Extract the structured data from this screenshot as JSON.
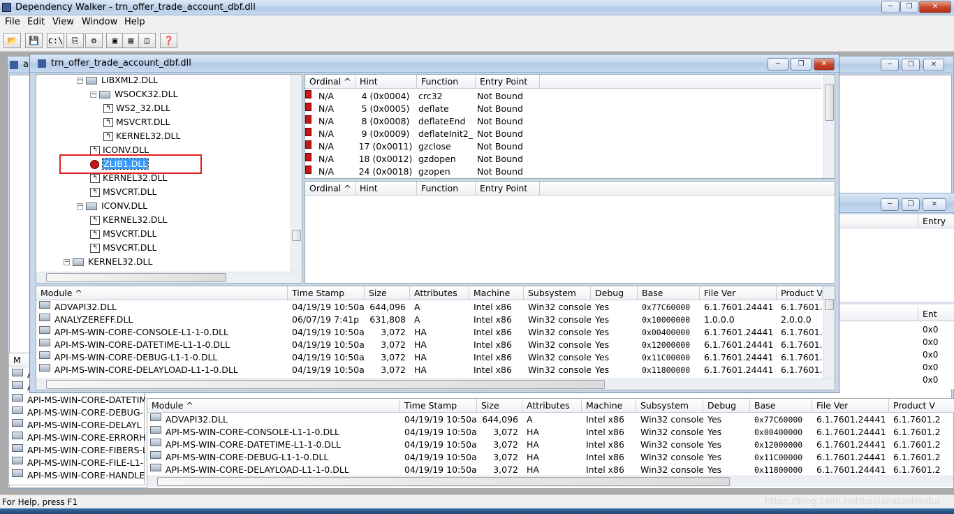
{
  "app": {
    "title": "Dependency Walker - trn_offer_trade_account_dbf.dll",
    "status": "For Help, press F1",
    "watermark": "https://blog.csdn.net/baijianxiaofendui"
  },
  "menu": [
    "File",
    "Edit",
    "View",
    "Window",
    "Help"
  ],
  "toolbar": {
    "b1": "open-icon",
    "b2": "save-icon",
    "b3": "c:\\",
    "b4": "copy-icon",
    "b5": "config-icon",
    "b6": "full-paths-icon",
    "b7": "undecorate-icon",
    "b8": "cascade-icon",
    "b9": "tile-horizontal-icon",
    "b10": "tile-vertical-icon",
    "b11": "help-icon"
  },
  "bgwin": {
    "title": "a",
    "entry": "Entry",
    "ent": "Ent",
    "m": "M",
    "ox": [
      "0x0",
      "0x0",
      "0x0",
      "0x0",
      "0x0"
    ],
    "left_items": [
      "A",
      "A",
      "API-MS-WIN-CORE-DATETIM",
      "API-MS-WIN-CORE-DEBUG-",
      "API-MS-WIN-CORE-DELAYL",
      "API-MS-WIN-CORE-ERRORH",
      "API-MS-WIN-CORE-FIBERS-L",
      "API-MS-WIN-CORE-FILE-L1-",
      "API-MS-WIN-CORE-HANDLE"
    ]
  },
  "child": {
    "title": "trn_offer_trade_account_dbf.dll"
  },
  "tree": [
    {
      "label": "LIBXML2.DLL",
      "exp": "−"
    },
    {
      "label": "WSOCK32.DLL",
      "exp": "−"
    },
    {
      "label": "WS2_32.DLL"
    },
    {
      "label": "MSVCRT.DLL"
    },
    {
      "label": "KERNEL32.DLL"
    },
    {
      "label": "ICONV.DLL"
    },
    {
      "label": "ZLIB1.DLL"
    },
    {
      "label": "KERNEL32.DLL"
    },
    {
      "label": "MSVCRT.DLL"
    },
    {
      "label": "ICONV.DLL",
      "exp": "−"
    },
    {
      "label": "KERNEL32.DLL"
    },
    {
      "label": "MSVCRT.DLL"
    },
    {
      "label": "MSVCRT.DLL"
    },
    {
      "label": "KERNEL32.DLL",
      "exp": "−"
    }
  ],
  "import_headers": [
    "Ordinal ^",
    "Hint",
    "Function",
    "Entry Point"
  ],
  "imports": [
    [
      "N/A",
      "4  (0x0004)",
      "crc32",
      "Not Bound"
    ],
    [
      "N/A",
      "5  (0x0005)",
      "deflate",
      "Not Bound"
    ],
    [
      "N/A",
      "8  (0x0008)",
      "deflateEnd",
      "Not Bound"
    ],
    [
      "N/A",
      "9  (0x0009)",
      "deflateInit2_",
      "Not Bound"
    ],
    [
      "N/A",
      "17  (0x0011)",
      "gzclose",
      "Not Bound"
    ],
    [
      "N/A",
      "18  (0x0012)",
      "gzdopen",
      "Not Bound"
    ],
    [
      "N/A",
      "24  (0x0018)",
      "gzopen",
      "Not Bound"
    ]
  ],
  "module_headers": [
    "Module ^",
    "Time Stamp",
    "Size",
    "Attributes",
    "Machine",
    "Subsystem",
    "Debug",
    "Base",
    "File Ver",
    "Product V"
  ],
  "modules": [
    [
      "ADVAPI32.DLL",
      "04/19/19  10:50a",
      "644,096",
      "A",
      "Intel x86",
      "Win32 console",
      "Yes",
      "0x77C60000",
      "6.1.7601.24441",
      "6.1.7601.2"
    ],
    [
      "ANALYZEREFF.DLL",
      "06/07/19    7:41p",
      "631,808",
      "A",
      "Intel x86",
      "Win32 console",
      "Yes",
      "0x10000000",
      "1.0.0.0",
      "2.0.0.0"
    ],
    [
      "API-MS-WIN-CORE-CONSOLE-L1-1-0.DLL",
      "04/19/19  10:50a",
      "3,072",
      "HA",
      "Intel x86",
      "Win32 console",
      "Yes",
      "0x00400000",
      "6.1.7601.24441",
      "6.1.7601.2"
    ],
    [
      "API-MS-WIN-CORE-DATETIME-L1-1-0.DLL",
      "04/19/19  10:50a",
      "3,072",
      "HA",
      "Intel x86",
      "Win32 console",
      "Yes",
      "0x12000000",
      "6.1.7601.24441",
      "6.1.7601.2"
    ],
    [
      "API-MS-WIN-CORE-DEBUG-L1-1-0.DLL",
      "04/19/19  10:50a",
      "3,072",
      "HA",
      "Intel x86",
      "Win32 console",
      "Yes",
      "0x11C00000",
      "6.1.7601.24441",
      "6.1.7601.2"
    ],
    [
      "API-MS-WIN-CORE-DELAYLOAD-L1-1-0.DLL",
      "04/19/19  10:50a",
      "3,072",
      "HA",
      "Intel x86",
      "Win32 console",
      "Yes",
      "0x11800000",
      "6.1.7601.24441",
      "6.1.7601.2"
    ]
  ],
  "modules2": [
    [
      "ADVAPI32.DLL",
      "04/19/19  10:50a",
      "644,096",
      "A",
      "Intel x86",
      "Win32 console",
      "Yes",
      "0x77C60000",
      "6.1.7601.24441",
      "6.1.7601.2"
    ],
    [
      "API-MS-WIN-CORE-CONSOLE-L1-1-0.DLL",
      "04/19/19  10:50a",
      "3,072",
      "HA",
      "Intel x86",
      "Win32 console",
      "Yes",
      "0x00400000",
      "6.1.7601.24441",
      "6.1.7601.2"
    ],
    [
      "API-MS-WIN-CORE-DATETIME-L1-1-0.DLL",
      "04/19/19  10:50a",
      "3,072",
      "HA",
      "Intel x86",
      "Win32 console",
      "Yes",
      "0x12000000",
      "6.1.7601.24441",
      "6.1.7601.2"
    ],
    [
      "API-MS-WIN-CORE-DEBUG-L1-1-0.DLL",
      "04/19/19  10:50a",
      "3,072",
      "HA",
      "Intel x86",
      "Win32 console",
      "Yes",
      "0x11C00000",
      "6.1.7601.24441",
      "6.1.7601.2"
    ],
    [
      "API-MS-WIN-CORE-DELAYLOAD-L1-1-0.DLL",
      "04/19/19  10:50a",
      "3,072",
      "HA",
      "Intel x86",
      "Win32 console",
      "Yes",
      "0x11800000",
      "6.1.7601.24441",
      "6.1.7601.2"
    ]
  ],
  "colors": {
    "title_bar": "#c6d9ef",
    "highlight": "#3399ff",
    "error_box": "#e02020",
    "error_icon": "#c21818"
  }
}
